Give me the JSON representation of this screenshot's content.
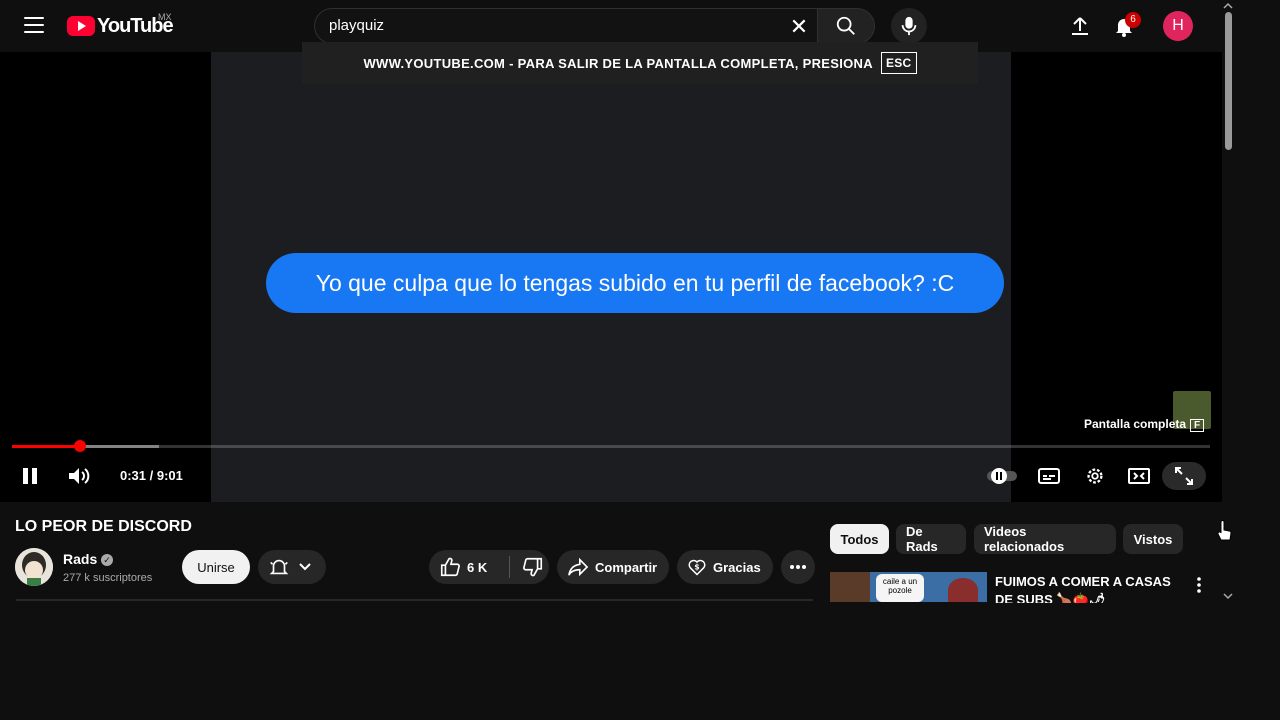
{
  "header": {
    "logo_text": "YouTube",
    "country_code": "MX",
    "search_value": "playquiz",
    "notifications_count": "6",
    "avatar_letter": "H"
  },
  "fullscreen_banner": {
    "text": "WWW.YOUTUBE.COM - PARA SALIR DE LA PANTALLA COMPLETA, PRESIONA",
    "key": "ESC"
  },
  "player": {
    "message": "Yo que culpa que lo tengas subido en tu perfil de facebook? :C",
    "fullscreen_tip": "Pantalla completa",
    "fullscreen_key": "F",
    "time": "0:31 / 9:01",
    "progress_fraction": 0.057,
    "buffered_fraction": 0.123
  },
  "video": {
    "title": "LO PEOR DE DISCORD",
    "channel_name": "Rads",
    "subscribers": "277 k suscriptores",
    "join_label": "Unirse",
    "like_count": "6 K",
    "share_label": "Compartir",
    "thanks_label": "Gracias"
  },
  "chips": [
    "Todos",
    "De Rads",
    "Videos relacionados",
    "Vistos"
  ],
  "recommendation": {
    "title": "FUIMOS A COMER A CASAS DE SUBS 🍗🍅🌶",
    "thumb_caption": "caile a un pozole"
  },
  "colors": {
    "accent": "#ff0000",
    "bubble": "#1877f2",
    "background": "#0f0f0f"
  }
}
